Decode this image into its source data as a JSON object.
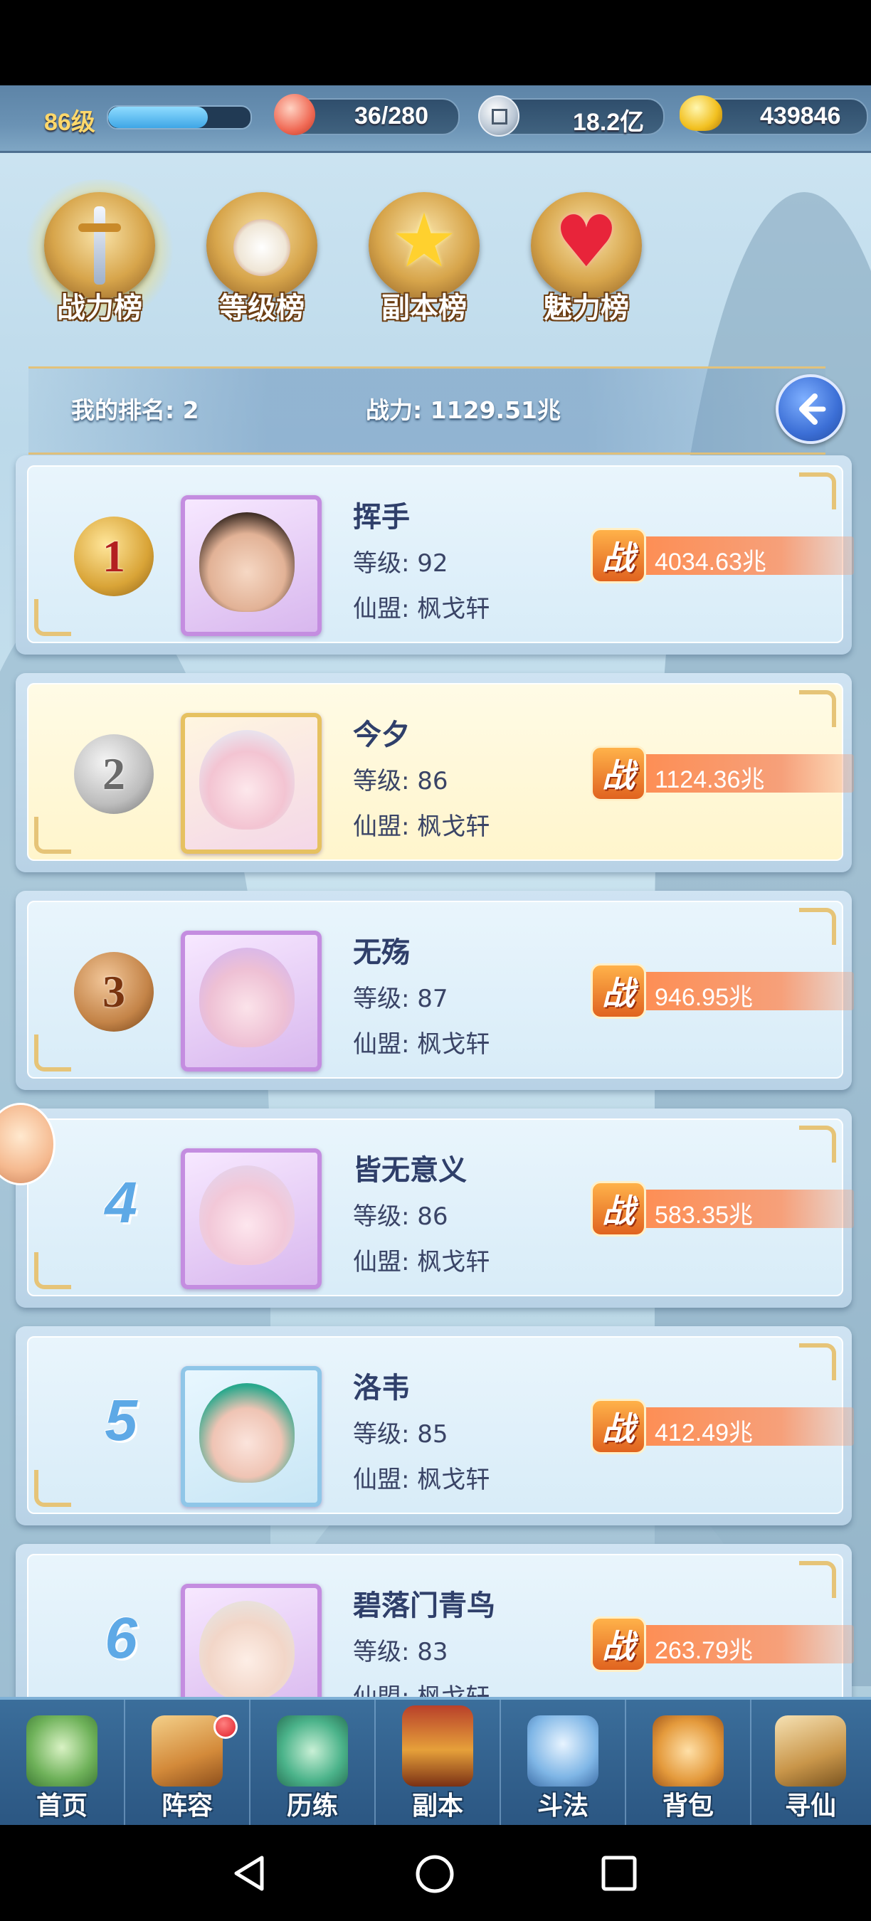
{
  "topbar": {
    "level": "86级",
    "level_progress": 0.7,
    "stamina": "36/280",
    "silver": "18.2亿",
    "gold": "439846"
  },
  "tabs": [
    {
      "label": "战力榜",
      "active": true
    },
    {
      "label": "等级榜",
      "active": false
    },
    {
      "label": "副本榜",
      "active": false
    },
    {
      "label": "魅力榜",
      "active": false
    }
  ],
  "my_rank": {
    "rank_label": "我的排名: 2",
    "power_label": "战力: 1129.51兆"
  },
  "power_icon_text": "战",
  "players": [
    {
      "rank": "1",
      "name": "挥手",
      "level": "等级: 92",
      "guild": "仙盟: 枫戈轩",
      "power": "4034.63兆"
    },
    {
      "rank": "2",
      "name": "今夕",
      "level": "等级: 86",
      "guild": "仙盟: 枫戈轩",
      "power": "1124.36兆"
    },
    {
      "rank": "3",
      "name": "无殇",
      "level": "等级: 87",
      "guild": "仙盟: 枫戈轩",
      "power": "946.95兆"
    },
    {
      "rank": "4",
      "name": "皆无意义",
      "level": "等级: 86",
      "guild": "仙盟: 枫戈轩",
      "power": "583.35兆"
    },
    {
      "rank": "5",
      "name": "洛韦",
      "level": "等级: 85",
      "guild": "仙盟: 枫戈轩",
      "power": "412.49兆"
    },
    {
      "rank": "6",
      "name": "碧落门青鸟",
      "level": "等级: 83",
      "guild": "仙盟: 枫戈轩",
      "power": "263.79兆"
    }
  ],
  "nav": [
    {
      "label": "首页"
    },
    {
      "label": "阵容"
    },
    {
      "label": "历练"
    },
    {
      "label": "副本"
    },
    {
      "label": "斗法"
    },
    {
      "label": "背包"
    },
    {
      "label": "寻仙"
    }
  ],
  "colors": {
    "accent_blue": "#3c6fd6",
    "power_orange": "#ff8a4c",
    "gold_trim": "#e6c478"
  }
}
